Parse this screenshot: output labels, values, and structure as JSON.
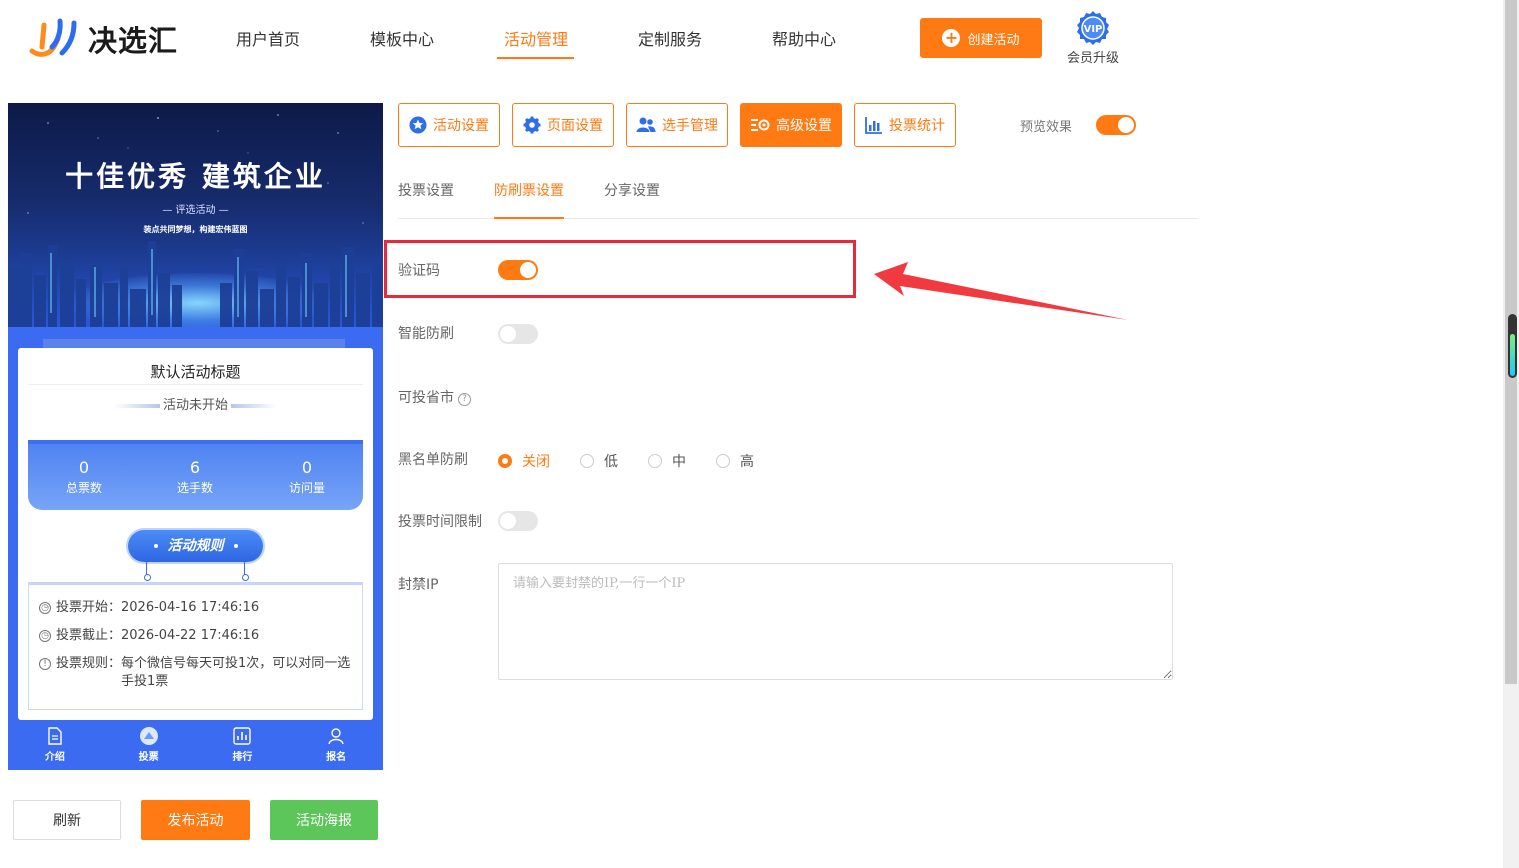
{
  "header": {
    "brand": "决选汇",
    "nav": [
      {
        "label": "用户首页"
      },
      {
        "label": "模板中心"
      },
      {
        "label": "活动管理",
        "active": true
      },
      {
        "label": "定制服务"
      },
      {
        "label": "帮助中心"
      }
    ],
    "create_label": "创建活动",
    "vip_badge": "VIP",
    "vip_label": "会员升级"
  },
  "preview": {
    "hero_title": "十佳优秀 建筑企业",
    "hero_sub": "— 评选活动 —",
    "hero_sub2": "装点共同梦想，构建宏伟蓝图",
    "activity_title": "默认活动标题",
    "status": "活动未开始",
    "stats": [
      {
        "value": "0",
        "label": "总票数"
      },
      {
        "value": "6",
        "label": "选手数"
      },
      {
        "value": "0",
        "label": "访问量"
      }
    ],
    "rules_label": "活动规则",
    "info": [
      {
        "key": "投票开始：",
        "value": "2026-04-16 17:46:16",
        "icon": "clock-icon"
      },
      {
        "key": "投票截止：",
        "value": "2026-04-22 17:46:16",
        "icon": "clock-icon"
      },
      {
        "key": "投票规则：",
        "value": "每个微信号每天可投1次，可以对同一选手投1票",
        "icon": "info-icon"
      }
    ],
    "tabs": [
      {
        "label": "介绍",
        "icon": "document-icon"
      },
      {
        "label": "投票",
        "icon": "vote-icon"
      },
      {
        "label": "排行",
        "icon": "chart-icon"
      },
      {
        "label": "报名",
        "icon": "user-icon"
      }
    ]
  },
  "actions": {
    "refresh": "刷新",
    "publish": "发布活动",
    "poster": "活动海报"
  },
  "toolbar": {
    "buttons": [
      {
        "label": "活动设置",
        "icon": "star-icon"
      },
      {
        "label": "页面设置",
        "icon": "gear-icon"
      },
      {
        "label": "选手管理",
        "icon": "users-icon"
      },
      {
        "label": "高级设置",
        "icon": "settings-icon",
        "active": true
      },
      {
        "label": "投票统计",
        "icon": "bar-chart-icon"
      }
    ],
    "preview_label": "预览效果",
    "preview_on": true
  },
  "subtabs": [
    {
      "label": "投票设置"
    },
    {
      "label": "防刷票设置",
      "active": true
    },
    {
      "label": "分享设置"
    }
  ],
  "settings": {
    "captcha_label": "验证码",
    "captcha_on": true,
    "smart_label": "智能防刷",
    "smart_on": false,
    "region_label": "可投省市",
    "region_help": "?",
    "blacklist_label": "黑名单防刷",
    "blacklist_options": [
      "关闭",
      "低",
      "中",
      "高"
    ],
    "blacklist_selected": "关闭",
    "time_limit_label": "投票时间限制",
    "time_limit_on": false,
    "ip_label": "封禁IP",
    "ip_placeholder": "请输入要封禁的IP,一行一个IP",
    "ip_value": ""
  },
  "colors": {
    "accent": "#ff7a12",
    "highlight": "#e9283a",
    "preview_blue": "#3b6bf0",
    "poster_green": "#5cc65a"
  }
}
